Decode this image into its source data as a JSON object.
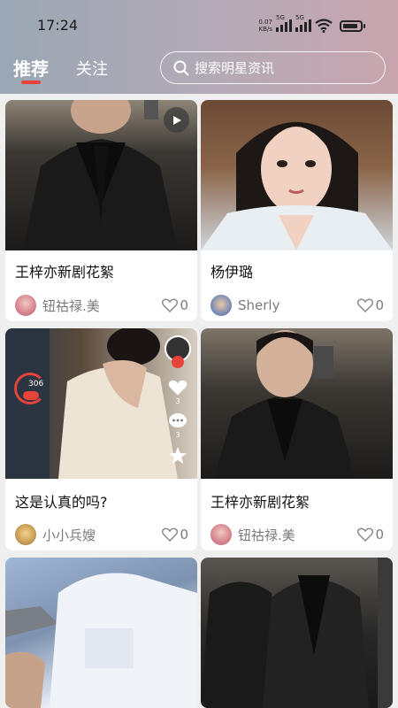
{
  "status_bar": {
    "time": "17:24",
    "net_speed_value": "0.07",
    "net_speed_unit": "KB/s",
    "signal_label_1": "5G",
    "signal_label_2": "5G"
  },
  "tabs": [
    {
      "label": "推荐",
      "active": true
    },
    {
      "label": "关注",
      "active": false
    }
  ],
  "search": {
    "placeholder": "搜索明星资讯"
  },
  "colors": {
    "accent": "#e8433b",
    "header_start": "#9aa7b4",
    "header_end": "#c8a5ae"
  },
  "feed": [
    {
      "title": "王梓亦新剧花絮",
      "author": "钮祜禄.美",
      "likes": "0",
      "has_play_icon": true
    },
    {
      "title": "杨伊璐",
      "author": "Sherly",
      "likes": "0",
      "has_play_icon": false
    },
    {
      "title": "这是认真的吗?",
      "author": "小小兵嫂",
      "likes": "0",
      "has_play_icon": false,
      "overlay": {
        "recording_label": "306",
        "like_count": "3",
        "comment_count": "3"
      }
    },
    {
      "title": "王梓亦新剧花絮",
      "author": "钮祜禄.美",
      "likes": "0",
      "has_play_icon": false
    },
    {
      "title": "",
      "author": "",
      "likes": "",
      "has_play_icon": false
    },
    {
      "title": "",
      "author": "",
      "likes": "",
      "has_play_icon": false
    }
  ]
}
